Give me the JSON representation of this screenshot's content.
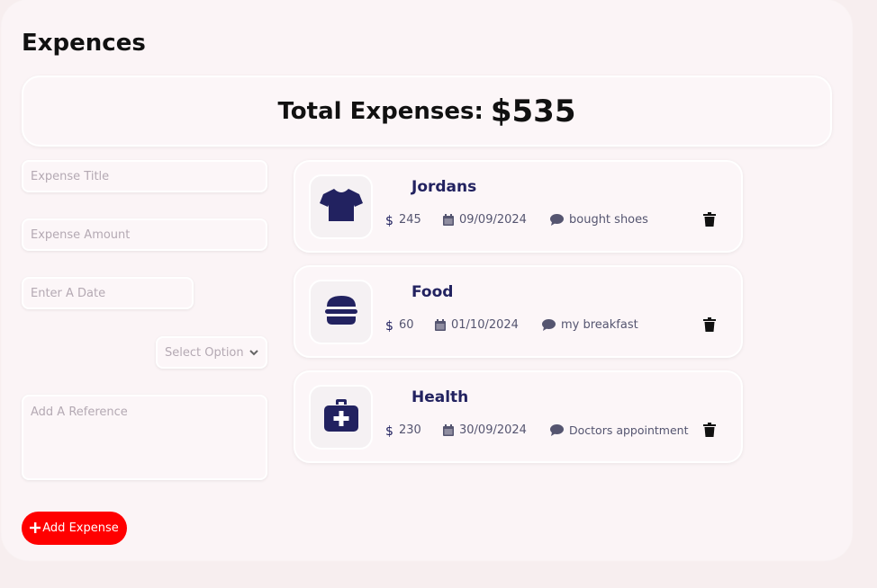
{
  "page": {
    "title": "Expences"
  },
  "total": {
    "label": "Total Expenses:",
    "value": "$535"
  },
  "form": {
    "title_placeholder": "Expense Title",
    "amount_placeholder": "Expense Amount",
    "date_placeholder": "Enter A Date",
    "select_value": "Select Option",
    "reference_placeholder": "Add A Reference",
    "add_button_label": "Add Expense"
  },
  "expenses": [
    {
      "icon": "shirt-icon",
      "title": "Jordans",
      "amount": "245",
      "date": "09/09/2024",
      "note": "bought shoes"
    },
    {
      "icon": "burger-icon",
      "title": "Food",
      "amount": "60",
      "date": "01/10/2024",
      "note": "my breakfast"
    },
    {
      "icon": "medical-kit-icon",
      "title": "Health",
      "amount": "230",
      "date": "30/09/2024",
      "note": "Doctors appointment"
    }
  ],
  "colors": {
    "accent": "#ff0000",
    "icon": "#222260",
    "panel": "#fbf4f6"
  }
}
